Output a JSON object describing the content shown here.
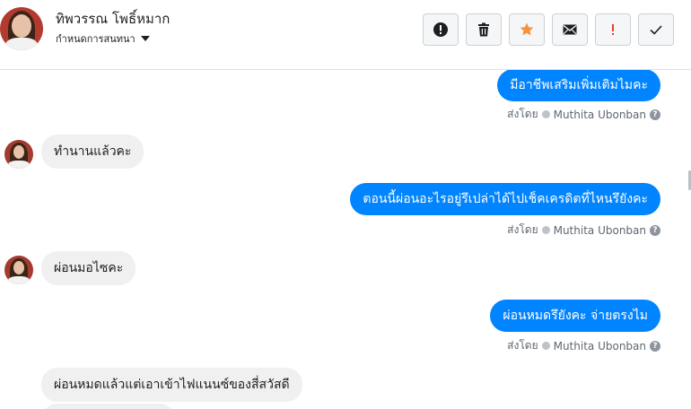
{
  "header": {
    "user_name": "ทิพวรรณ โพธิ์หมาก",
    "conversation_settings": "กำหนดการสนทนา",
    "actions": [
      {
        "name": "report-icon",
        "color": "#1c1e21"
      },
      {
        "name": "trash-icon",
        "color": "#1c1e21"
      },
      {
        "name": "star-icon",
        "color": "#f7923a"
      },
      {
        "name": "mail-icon",
        "color": "#1c1e21"
      },
      {
        "name": "important-icon",
        "color": "#e4402f"
      },
      {
        "name": "check-icon",
        "color": "#1c1e21"
      }
    ]
  },
  "messages": [
    {
      "direction": "out",
      "text": "มีอาชีพเสริมเพิ่มเติมไมคะ"
    },
    {
      "type": "sent_by",
      "label": "ส่งโดย",
      "sender": "Muthita Ubonban"
    },
    {
      "direction": "in",
      "text": "ทำนานแล้วคะ"
    },
    {
      "direction": "out",
      "text": "ตอนนี้ผ่อนอะไรอยู่รึเปล่าได้ไปเช็คเครดิตที่ไหนรึยังคะ"
    },
    {
      "type": "sent_by",
      "label": "ส่งโดย",
      "sender": "Muthita Ubonban"
    },
    {
      "direction": "in",
      "text": "ผ่อนมอไซคะ"
    },
    {
      "direction": "out",
      "text": "ผ่อนหมดรึยังคะ จ่ายตรงไม"
    },
    {
      "type": "sent_by",
      "label": "ส่งโดย",
      "sender": "Muthita Ubonban"
    },
    {
      "direction": "in",
      "text": "ผ่อนหมดแล้วแต่เอาเข้าไฟแนนซ์ของสี่สวัสดี"
    }
  ],
  "colors": {
    "outgoing_bubble": "#0084ff",
    "incoming_bubble": "#f1f0f0"
  }
}
